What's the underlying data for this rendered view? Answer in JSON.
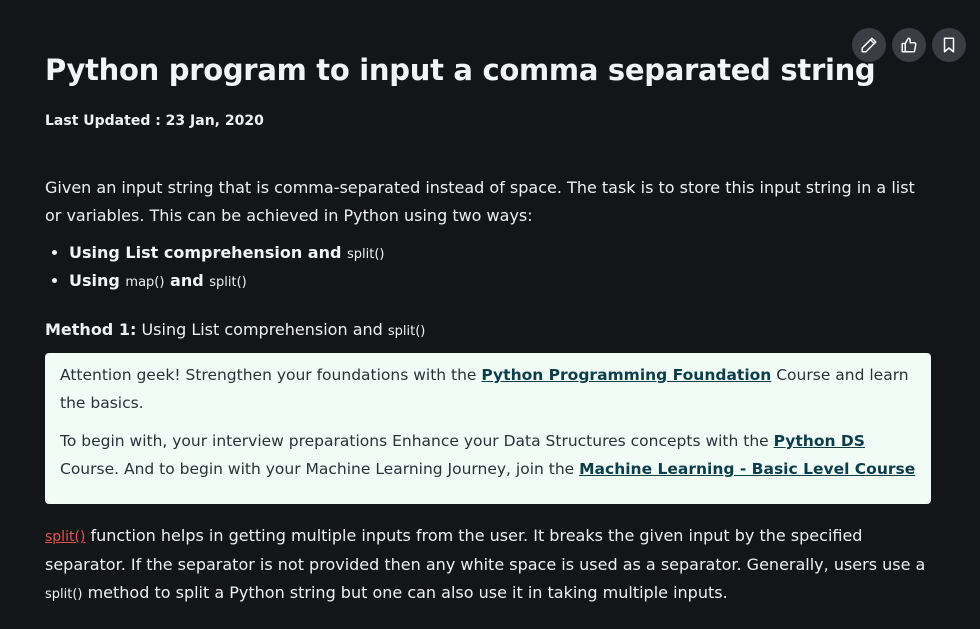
{
  "toolbar": {
    "edit_icon": "pencil-icon",
    "like_icon": "thumbs-up-icon",
    "bookmark_icon": "bookmark-icon"
  },
  "article": {
    "title": "Python program to input a comma separated string",
    "last_updated": "Last Updated : 23 Jan, 2020",
    "intro": "Given an input string that is comma-separated instead of space. The task is to store this input string in a list or variables. This can be achieved in Python using two ways:",
    "methods": [
      {
        "text": "Using List comprehension and ",
        "code": "split()"
      },
      {
        "text_before": "Using ",
        "code1": "map()",
        "text_middle": " and ",
        "code2": "split()"
      }
    ],
    "method1": {
      "label": "Method 1:",
      "text": " Using List comprehension and ",
      "code": "split()"
    },
    "callout": {
      "p1_before": " Attention geek! Strengthen your foundations with the ",
      "p1_link": "Python Programming Foundation",
      "p1_after": " Course and learn the basics.",
      "p2_before": "To begin with, your interview preparations Enhance your Data Structures concepts with the ",
      "p2_link1": "Python DS",
      "p2_middle": " Course. And to begin with your Machine Learning Journey, join the ",
      "p2_link2": "Machine Learning - Basic Level Course"
    },
    "body": {
      "split_link": "split()",
      "text1": " function helps in getting multiple inputs from the user. It breaks the given input by the specified separator. If the separator is not provided then any white space is used as a separator. Generally, users use a ",
      "code": "split()",
      "text2": " method to split a Python string but one can also use it in taking multiple inputs."
    }
  },
  "colors": {
    "background": "#141519",
    "callout_bg": "#f2fcf7",
    "link_red": "#e2554c",
    "button_bg": "#3b3d44"
  }
}
